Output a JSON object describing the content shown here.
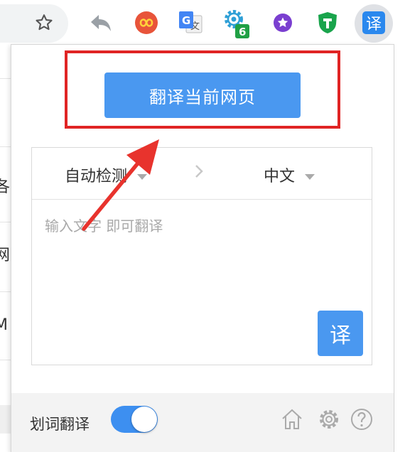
{
  "toolbar": {
    "icons": [
      "star-icon",
      "back-arrow-icon",
      "infinity-extension-icon",
      "google-translate-icon",
      "gear-extension-icon",
      "purple-star-extension-icon",
      "green-shield-extension-icon",
      "translate-extension-icon"
    ],
    "gear_badge": "6",
    "active_extension_label": "译",
    "colors": {
      "infinity": "#e8543a",
      "gear": "#2e9fd6",
      "badge": "#20a045",
      "purple": "#7a3fd0",
      "shield": "#19a44c",
      "translate_ext": "#2a88ee"
    }
  },
  "page_behind": {
    "chars": [
      "各",
      "网",
      "M"
    ]
  },
  "popup": {
    "translate_page_button": "翻译当前网页",
    "source_language": "自动检测",
    "target_language": "中文",
    "input": {
      "value": "",
      "placeholder": "输入文字 即可翻译"
    },
    "translate_button": "译",
    "footer": {
      "label": "划词翻译",
      "toggle_on": true,
      "icons": [
        "home-icon",
        "settings-icon",
        "help-icon"
      ]
    },
    "colors": {
      "accent": "#4a98f0",
      "highlight": "#e02424"
    }
  }
}
